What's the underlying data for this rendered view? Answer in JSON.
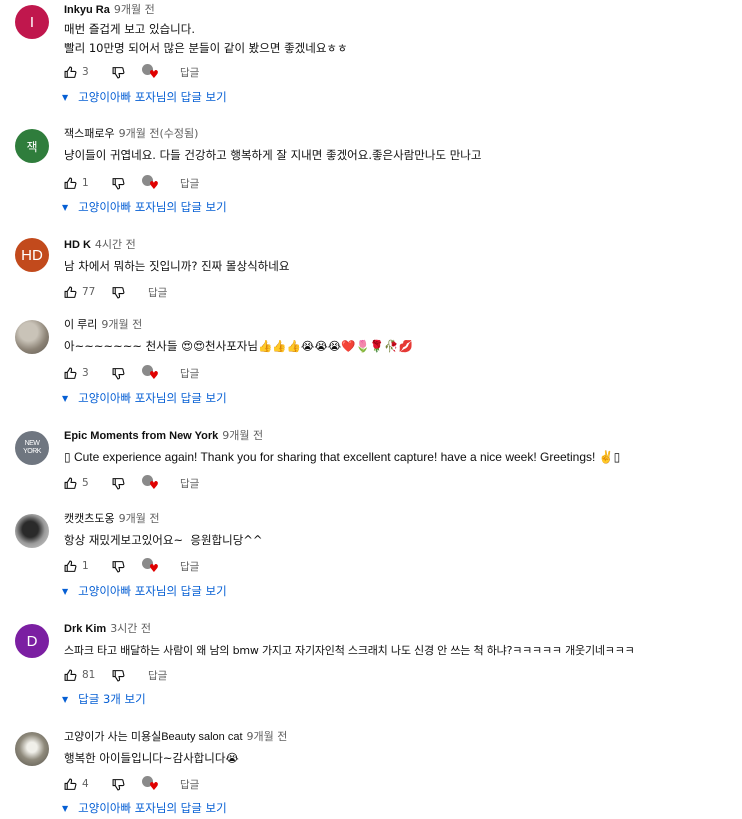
{
  "icons": {
    "like": "thumb-up-icon",
    "dislike": "thumb-down-icon",
    "creator_heart": "creator-heart-icon",
    "expand": "caret-down-icon"
  },
  "colors": {
    "link_blue": "#065fd4",
    "heart_red": "#e00000",
    "meta_gray": "#606060"
  },
  "comments": [
    {
      "avatar_letter": "I",
      "avatar_color": "#c0174d",
      "author": "Inkyu Ra",
      "time": "9개월 전",
      "lines": [
        "매번 즐겁게 보고 있습니다.",
        "빨리 10만명 되어서 많은 분들이 같이 봤으면 좋겠네요ㅎㅎ"
      ],
      "likes": "3",
      "reply_label": "답글",
      "replies_label": "고양이아빠 포자님의 답글 보기"
    },
    {
      "avatar_letter": "잭",
      "avatar_color": "#2f7d3c",
      "author": "잭스패로우",
      "time": "9개월 전(수정됨)",
      "lines": [
        "냥이들이 귀엽네요. 다들 건강하고 행복하게 잘 지내면 좋겠어요.좋은사람만나도 만나고"
      ],
      "likes": "1",
      "reply_label": "답글",
      "replies_label": "고양이아빠 포자님의 답글 보기"
    },
    {
      "avatar_letter": "HD",
      "avatar_color": "#c24a1c",
      "author": "HD K",
      "time": "4시간 전",
      "lines": [
        "남 차에서 뭐하는 짓입니까? 진짜 몰상식하네요"
      ],
      "likes": "77",
      "reply_label": "답글"
    },
    {
      "avatar_letter": "",
      "avatar_color": "#a7a29a",
      "author": "이 루리",
      "time": "9개월 전",
      "lines": [
        "아~~~~~~~ 천사들 😍😍천사포자님👍👍👍😭😭😭❤️🌷🌹🥀💋"
      ],
      "likes": "3",
      "reply_label": "답글",
      "replies_label": "고양이아빠 포자님의 답글 보기"
    },
    {
      "avatar_letter": "NEW YORK",
      "avatar_color": "#6f7680",
      "author": "Epic Moments from New York",
      "time": "9개월 전",
      "lines": [
        "▯ Cute experience again! Thank you for sharing that excellent capture! have a nice week! Greetings! ✌▯"
      ],
      "likes": "5",
      "reply_label": "답글"
    },
    {
      "avatar_letter": "",
      "avatar_color": "#8d8d8d",
      "author": "캣캣츠도옹",
      "time": "9개월 전",
      "lines": [
        "항상 재밌게보고있어요~  응원합니당^^"
      ],
      "likes": "1",
      "reply_label": "답글",
      "replies_label": "고양이아빠 포자님의 답글 보기"
    },
    {
      "avatar_letter": "D",
      "avatar_color": "#7b1fa2",
      "author": "Drk Kim",
      "time": "3시간 전",
      "lines": [
        "스파크 타고 배달하는 사람이 왜 남의 bmw 가지고 자기자인척 스크래치 나도 신경 안 쓰는 척 하냐?ㅋㅋㅋㅋㅋ 개웃기네ㅋㅋㅋ"
      ],
      "likes": "81",
      "reply_label": "답글",
      "replies_label": "답글 3개 보기"
    },
    {
      "avatar_letter": "",
      "avatar_color": "#9b9585",
      "author": "고양이가 사는 미용실Beauty salon cat",
      "time": "9개월 전",
      "lines": [
        "행복한 아이들입니다~감사합니다😭"
      ],
      "likes": "4",
      "reply_label": "답글",
      "replies_label": "고양이아빠 포자님의 답글 보기"
    }
  ]
}
